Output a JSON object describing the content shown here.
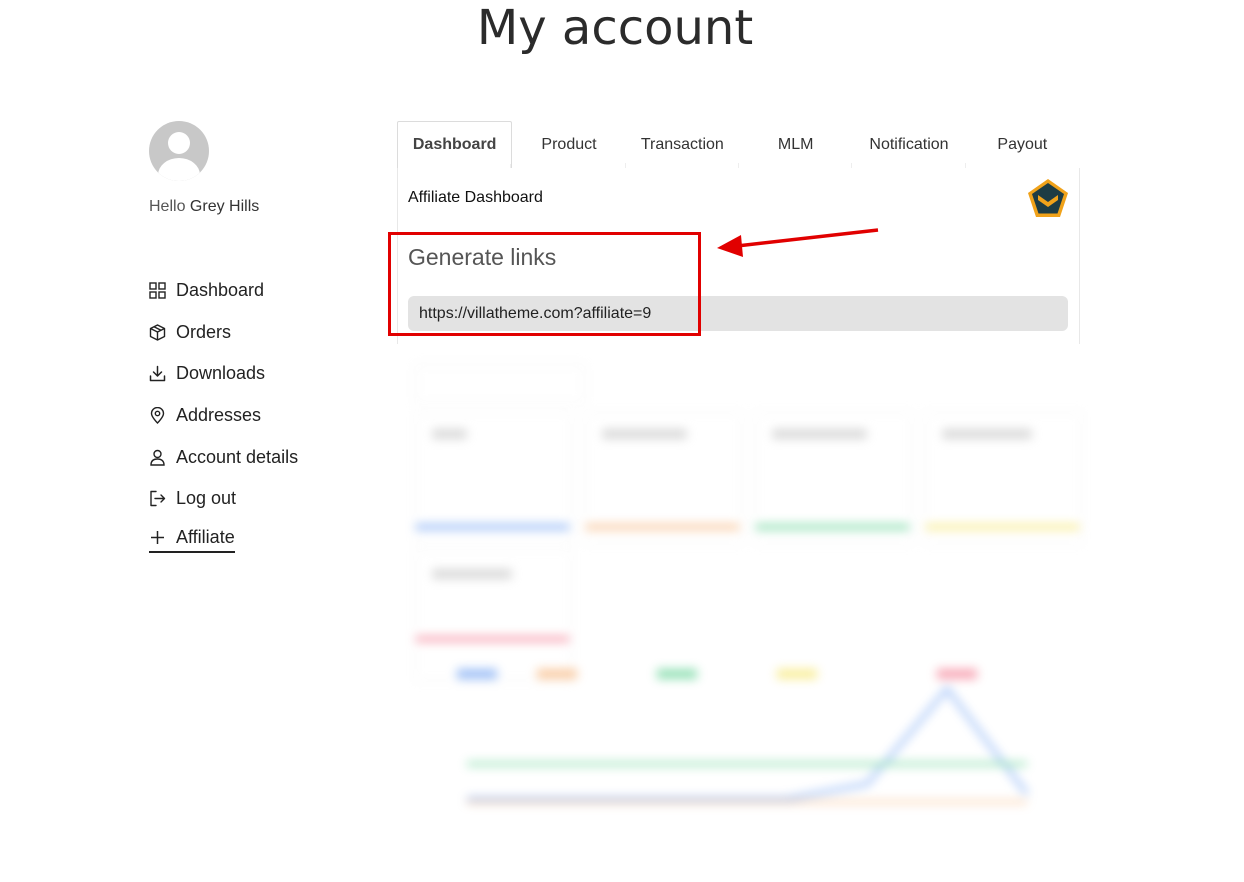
{
  "page": {
    "title": "My account"
  },
  "user": {
    "hello_word": "Hello",
    "name": "Grey Hills"
  },
  "sidebar": {
    "items": [
      {
        "label": "Dashboard",
        "icon": "grid-icon",
        "active": false
      },
      {
        "label": "Orders",
        "icon": "box-icon",
        "active": false
      },
      {
        "label": "Downloads",
        "icon": "download-icon",
        "active": false
      },
      {
        "label": "Addresses",
        "icon": "location-pin-icon",
        "active": false
      },
      {
        "label": "Account details",
        "icon": "user-icon",
        "active": false
      },
      {
        "label": "Log out",
        "icon": "logout-icon",
        "active": false
      },
      {
        "label": "Affiliate",
        "icon": "plus-icon",
        "active": true
      }
    ]
  },
  "tabs": [
    {
      "label": "Dashboard",
      "active": true
    },
    {
      "label": "Product",
      "active": false
    },
    {
      "label": "Transaction",
      "active": false
    },
    {
      "label": "MLM",
      "active": false
    },
    {
      "label": "Notification",
      "active": false
    },
    {
      "label": "Payout",
      "active": false
    }
  ],
  "dashboard": {
    "title": "Affiliate Dashboard",
    "badge_icon": "rank-chevron-badge-icon",
    "generate_links_title": "Generate links",
    "link_value": "https://villatheme.com?affiliate=9"
  },
  "annotation": {
    "box_color": "#e10000",
    "arrow_color": "#e10000"
  }
}
